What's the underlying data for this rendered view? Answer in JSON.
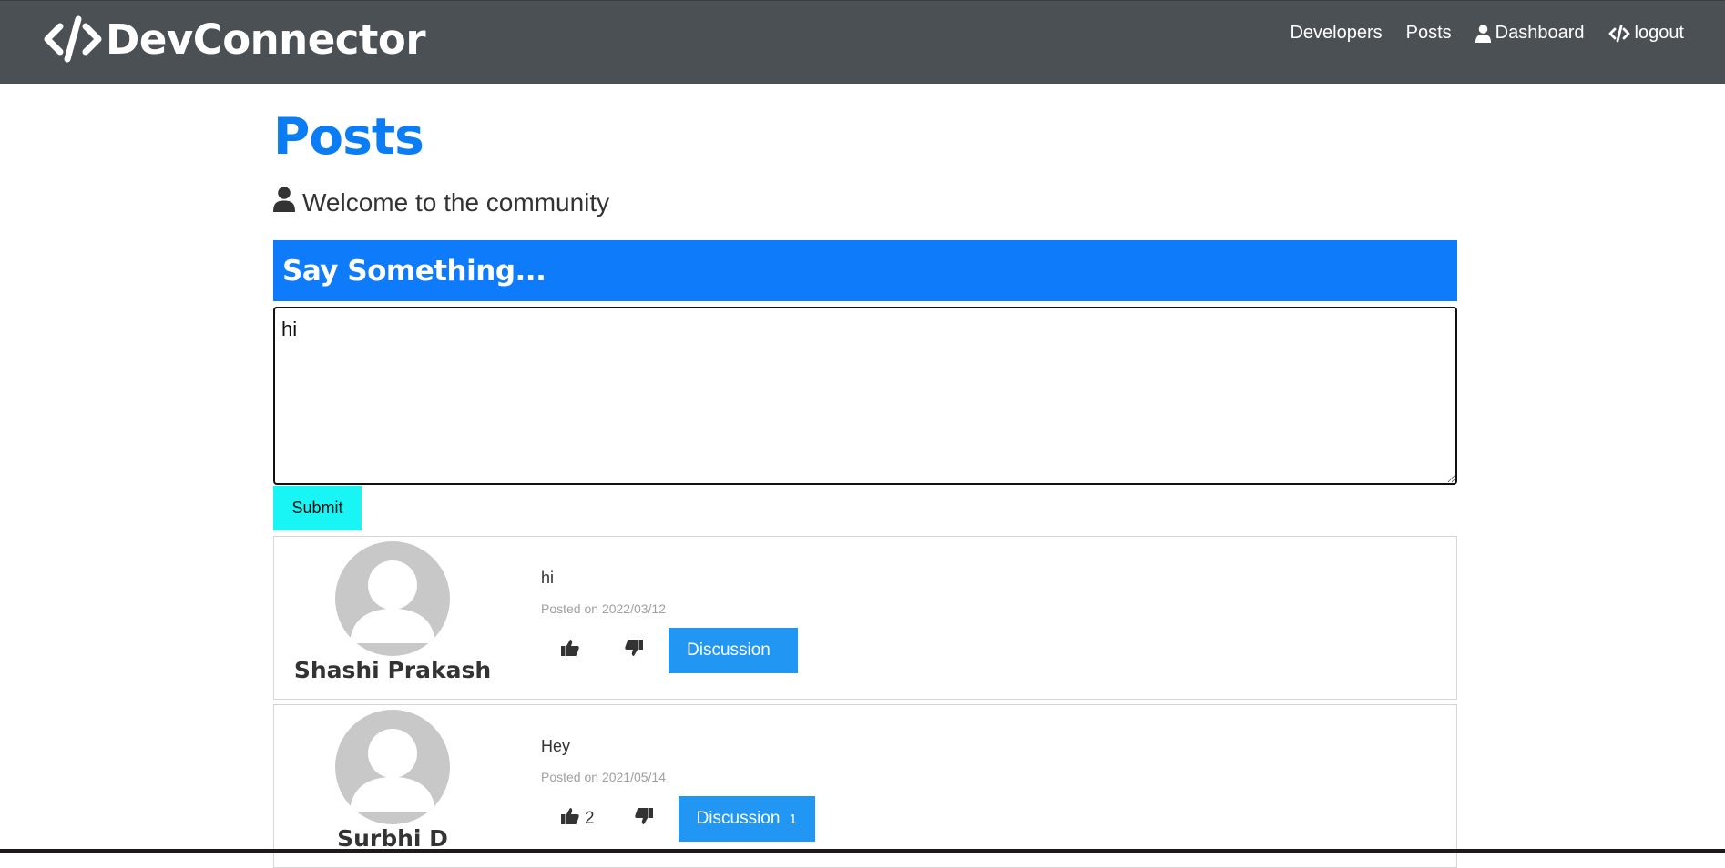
{
  "brand": {
    "name": "DevConnector",
    "icon": "code-icon"
  },
  "nav": {
    "developers": "Developers",
    "posts": "Posts",
    "dashboard": {
      "label": "Dashboard",
      "icon": "user-icon"
    },
    "logout": {
      "label": "logout",
      "icon": "code-icon"
    }
  },
  "page": {
    "title": "Posts",
    "lead": "Welcome to the community",
    "form_header": "Say Something...",
    "textarea_value": "hi",
    "submit_label": "Submit"
  },
  "posts": [
    {
      "author": "Shashi Prakash",
      "text": "hi",
      "date": "Posted on 2022/03/12",
      "likes": "",
      "discussion_label": "Discussion",
      "comments": ""
    },
    {
      "author": "Surbhi D",
      "text": "Hey",
      "date": "Posted on 2021/05/14",
      "likes": "2",
      "discussion_label": "Discussion",
      "comments": "1"
    }
  ],
  "colors": {
    "navbar": "#4b5055",
    "primary": "#0d7bfa",
    "submit": "#19f5f5",
    "discussion": "#2196f3"
  }
}
